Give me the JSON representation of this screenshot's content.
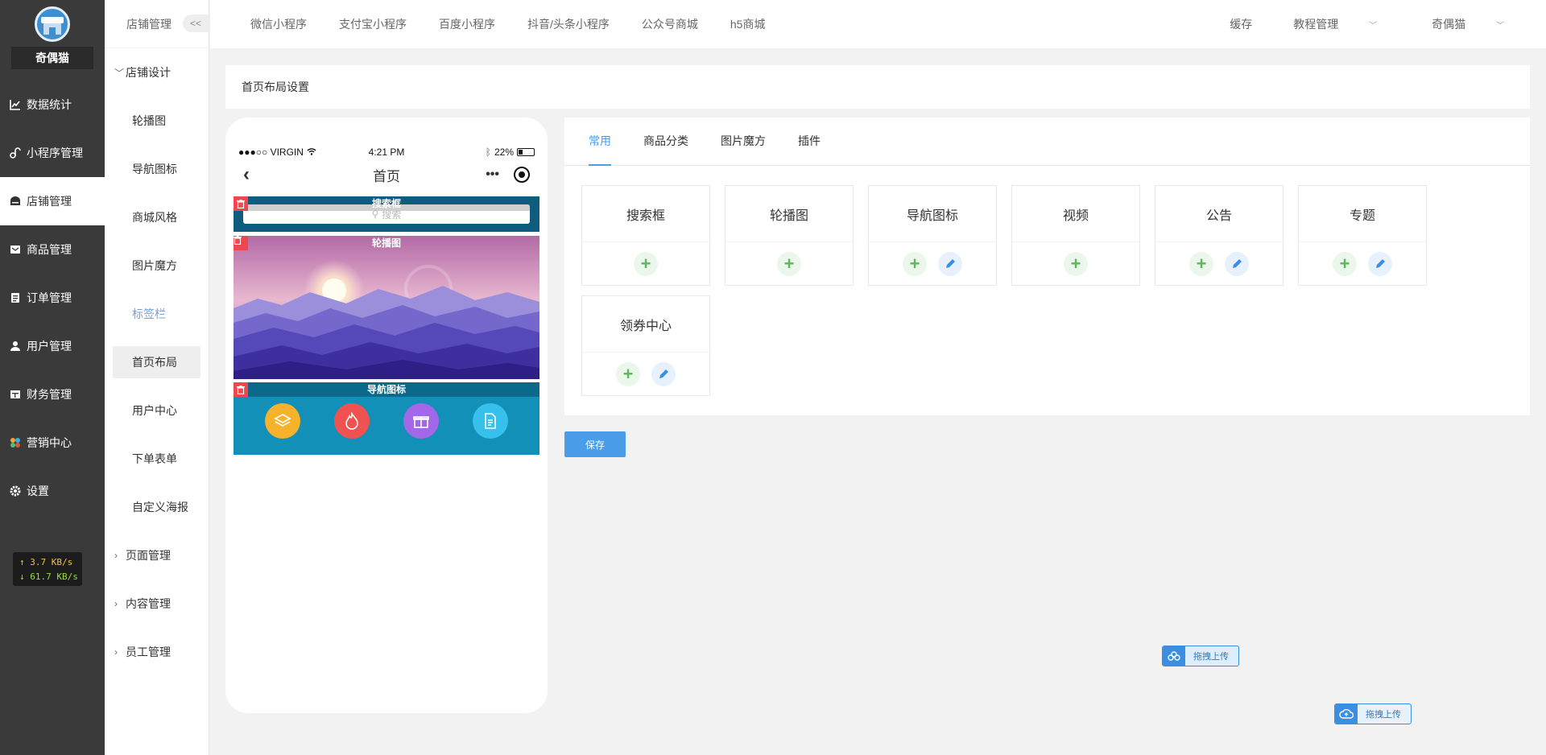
{
  "brand": {
    "name": "奇偶猫"
  },
  "sidebar": {
    "items": [
      {
        "label": "数据统计",
        "icon": "chart-icon"
      },
      {
        "label": "小程序管理",
        "icon": "miniapp-icon"
      },
      {
        "label": "店铺管理",
        "icon": "store-icon"
      },
      {
        "label": "商品管理",
        "icon": "goods-icon"
      },
      {
        "label": "订单管理",
        "icon": "order-icon"
      },
      {
        "label": "用户管理",
        "icon": "user-icon"
      },
      {
        "label": "财务管理",
        "icon": "finance-icon"
      },
      {
        "label": "营销中心",
        "icon": "marketing-icon"
      },
      {
        "label": "设置",
        "icon": "gear-icon"
      }
    ],
    "netspeed": {
      "up": "↑ 3.7 KB/s",
      "down": "↓ 61.7 KB/s"
    }
  },
  "submenu": {
    "title": "店铺管理",
    "collapse": "<<",
    "group_design": "店铺设计",
    "items": [
      "轮播图",
      "导航图标",
      "商城风格",
      "图片魔方",
      "标签栏",
      "首页布局",
      "用户中心",
      "下单表单",
      "自定义海报"
    ],
    "groups": [
      "页面管理",
      "内容管理",
      "员工管理"
    ]
  },
  "topbar": {
    "tabs": [
      "微信小程序",
      "支付宝小程序",
      "百度小程序",
      "抖音/头条小程序",
      "公众号商城",
      "h5商城"
    ],
    "cache": "缓存",
    "tutorial": "教程管理",
    "user": "奇偶猫"
  },
  "page": {
    "title": "首页布局设置"
  },
  "phone": {
    "carrier": "●●●○○ VIRGIN",
    "time": "4:21 PM",
    "battery": "22%",
    "title": "首页",
    "blocks": {
      "search": {
        "label": "搜索框",
        "placeholder": "搜索"
      },
      "banner": {
        "label": "轮播图"
      },
      "nav": {
        "label": "导航图标"
      }
    }
  },
  "panel": {
    "tabs": [
      "常用",
      "商品分类",
      "图片魔方",
      "插件"
    ],
    "cards": [
      {
        "name": "搜索框",
        "edit": false
      },
      {
        "name": "轮播图",
        "edit": false
      },
      {
        "name": "导航图标",
        "edit": true
      },
      {
        "name": "视频",
        "edit": false
      },
      {
        "name": "公告",
        "edit": true
      },
      {
        "name": "专题",
        "edit": true
      },
      {
        "name": "领券中心",
        "edit": true
      }
    ]
  },
  "save_label": "保存",
  "uploads": {
    "baidu": "拖拽上传",
    "cloud": "拖拽上传"
  },
  "colors": {
    "accent": "#4a9de8",
    "sidebar": "#3a3a3a",
    "add": "#5cb85c",
    "delete": "#f0464e"
  }
}
